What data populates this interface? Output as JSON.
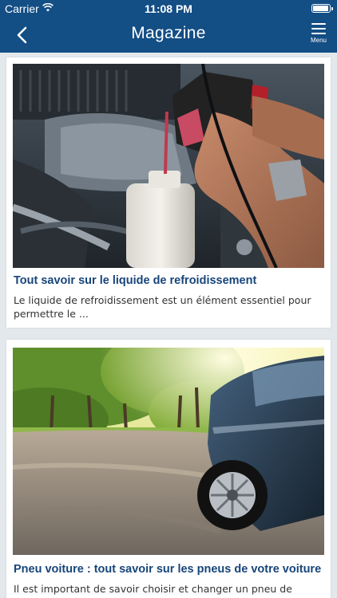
{
  "status": {
    "carrier": "Carrier",
    "time": "11:08 PM",
    "battery_level": 0.95
  },
  "nav": {
    "title": "Magazine",
    "menu_label": "Menu",
    "back_icon": "chevron-left-icon",
    "menu_icon": "hamburger-icon"
  },
  "articles": [
    {
      "title": "Tout savoir sur le liquide de refroidissement",
      "excerpt": "Le liquide de refroidissement est un élément essentiel pour permettre le ...",
      "image": "coolant-pouring-photo"
    },
    {
      "title": "Pneu voiture : tout savoir sur les pneus de votre voiture",
      "excerpt": "Il est important de savoir choisir et changer un pneu de voiture !",
      "image": "car-tyre-road-photo"
    }
  ],
  "colors": {
    "nav_bg": "#134e85",
    "title_text": "#17457a",
    "page_bg": "#e3e8ec"
  }
}
